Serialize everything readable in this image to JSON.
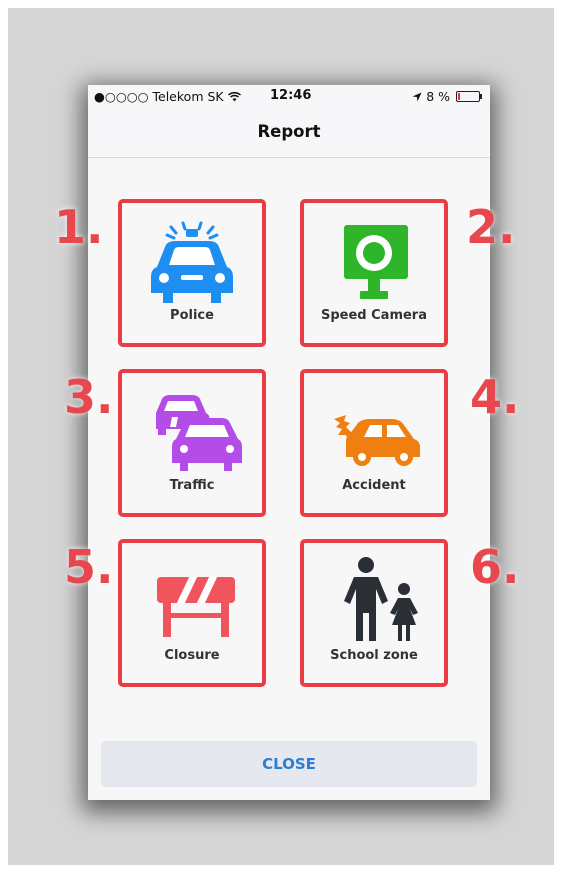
{
  "status_bar": {
    "carrier": "●○○○○ Telekom SK",
    "time": "12:46",
    "battery": "8 %"
  },
  "navbar": {
    "title": "Report"
  },
  "tiles": [
    {
      "number": "1.",
      "label": "Police",
      "icon": "police-car-icon",
      "color": "#1f8ef2"
    },
    {
      "number": "2.",
      "label": "Speed Camera",
      "icon": "speed-camera-icon",
      "color": "#2fb52a"
    },
    {
      "number": "3.",
      "label": "Traffic",
      "icon": "traffic-cars-icon",
      "color": "#b44de8"
    },
    {
      "number": "4.",
      "label": "Accident",
      "icon": "crashed-car-icon",
      "color": "#f07f12"
    },
    {
      "number": "5.",
      "label": "Closure",
      "icon": "road-barrier-icon",
      "color": "#f0545d"
    },
    {
      "number": "6.",
      "label": "School zone",
      "icon": "school-children-icon",
      "color": "#2a2f36"
    }
  ],
  "close_button": {
    "label": "CLOSE"
  },
  "colors": {
    "annotation": "#e8474e",
    "tile_border": "#ea3c43",
    "close_text": "#2a7fd4"
  }
}
